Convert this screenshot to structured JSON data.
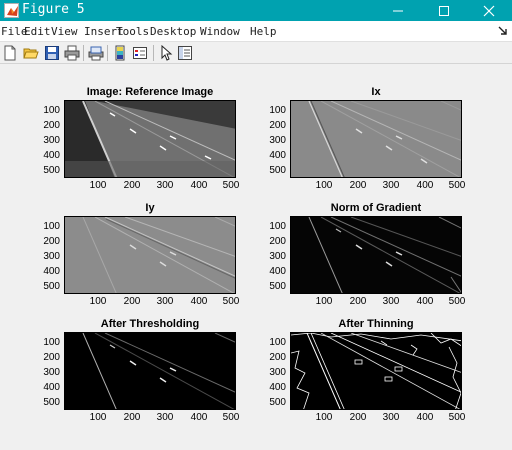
{
  "window": {
    "title": "Figure 5"
  },
  "menu": [
    "File",
    "Edit",
    "View",
    "Insert",
    "Tools",
    "Desktop",
    "Window",
    "Help"
  ],
  "toolbar": {
    "buttons": [
      "new-figure-icon",
      "open-file-icon",
      "save-icon",
      "print-icon",
      "print-preview-icon",
      "colorbar-icon",
      "legend-icon",
      "edit-plot-icon",
      "property-inspector-icon"
    ]
  },
  "panels": [
    {
      "title": "Image: Reference Image"
    },
    {
      "title": "Ix"
    },
    {
      "title": "Iy"
    },
    {
      "title": "Norm of Gradient"
    },
    {
      "title": "After Thresholding"
    },
    {
      "title": "After Thinning"
    }
  ],
  "axes": {
    "y_ticks": [
      "100",
      "200",
      "300",
      "400",
      "500"
    ],
    "x_ticks": [
      "100",
      "200",
      "300",
      "400",
      "500"
    ]
  }
}
